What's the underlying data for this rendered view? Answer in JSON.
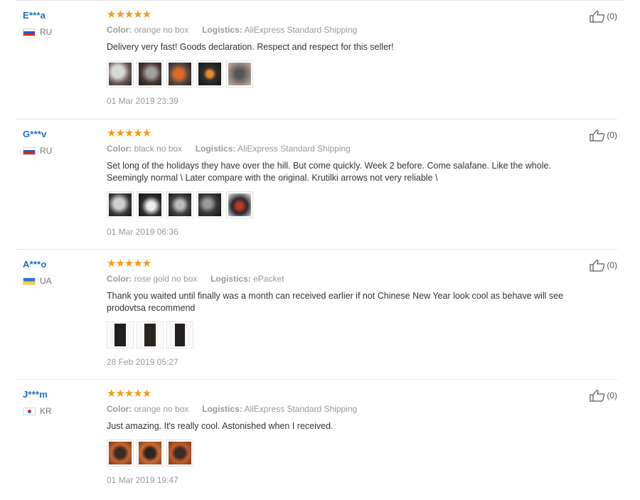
{
  "colors": {
    "username": "#1a6fc9",
    "stars": "#f39a15",
    "muted": "#999999",
    "text": "#333333",
    "divider": "#e6e6e6"
  },
  "labels": {
    "color": "Color:",
    "logistics": "Logistics:"
  },
  "reviews": [
    {
      "user": "E***a",
      "country": "RU",
      "flag": "ru",
      "rating": 5,
      "stars": "★★★★★",
      "color_value": "orange no box",
      "logistics_value": "AliExpress Standard Shipping",
      "text": "Delivery very fast! Goods declaration. Respect and respect for this seller!",
      "photo_icons": [
        "watch-photo",
        "watch-photo",
        "watch-photo",
        "watch-photo",
        "watch-photo"
      ],
      "date": "01 Mar 2019 23:39",
      "likes": "(0)"
    },
    {
      "user": "G***v",
      "country": "RU",
      "flag": "ru",
      "rating": 5,
      "stars": "★★★★★",
      "color_value": "black no box",
      "logistics_value": "AliExpress Standard Shipping",
      "text": "Set long of the holidays they have over the hill. But come quickly. Week 2 before. Come salafane. Like the whole. Seemingly normal \\ Later compare with the original. Krutilki arrows not very reliable \\",
      "photo_icons": [
        "watch-photo",
        "watch-photo",
        "watch-photo",
        "watch-photo",
        "watch-photo"
      ],
      "date": "01 Mar 2019 06:36",
      "likes": "(0)"
    },
    {
      "user": "A***o",
      "country": "UA",
      "flag": "ua",
      "rating": 5,
      "stars": "★★★★★",
      "color_value": "rose gold no box",
      "logistics_value": "ePacket",
      "text": "Thank you waited until finally was a month can received earlier if not Chinese New Year look cool as behave will see prodovtsa recommend",
      "photo_icons": [
        "watch-photo",
        "watch-photo",
        "watch-photo"
      ],
      "date": "28 Feb 2019 05:27",
      "likes": "(0)"
    },
    {
      "user": "J***m",
      "country": "KR",
      "flag": "kr",
      "rating": 5,
      "stars": "★★★★★",
      "color_value": "orange no box",
      "logistics_value": "AliExpress Standard Shipping",
      "text": "Just amazing. It's really cool. Astonished when I received.",
      "photo_icons": [
        "watch-photo",
        "watch-photo",
        "watch-photo"
      ],
      "date": "01 Mar 2019 19:47",
      "likes": "(0)"
    }
  ]
}
